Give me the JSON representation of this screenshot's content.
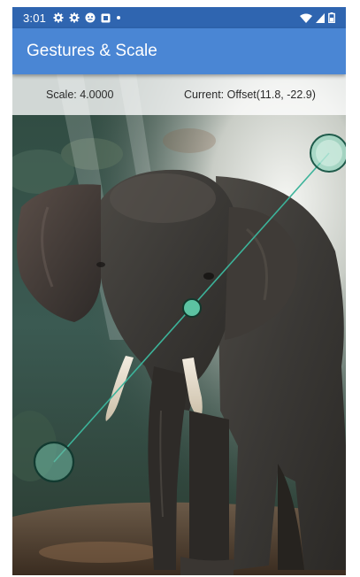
{
  "status_bar": {
    "time": "3:01",
    "left_icons": [
      "settings-icon",
      "settings-icon",
      "face-icon",
      "square-icon",
      "dot-icon"
    ],
    "right_icons": [
      "wifi-icon",
      "signal-icon",
      "battery-icon"
    ]
  },
  "app_bar": {
    "title": "Gestures & Scale"
  },
  "info": {
    "scale": "Scale: 4.0000",
    "current": "Current: Offset(11.8, -22.9)"
  },
  "colors": {
    "status_bar": "#2f65b0",
    "app_bar": "#4a86d4",
    "touch_point_fill": "#7fd3b8",
    "touch_point_stroke": "#1e5a4a",
    "connector_line": "#3cb39a"
  }
}
